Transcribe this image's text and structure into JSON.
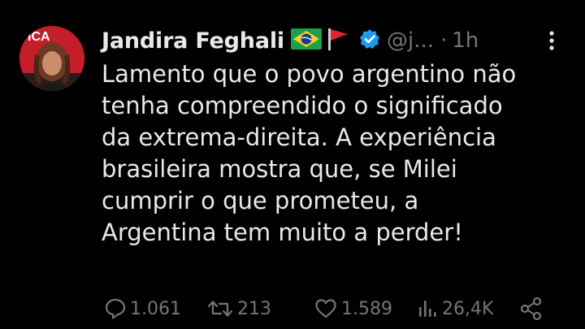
{
  "tweet": {
    "author_name": "Jandira Feghali",
    "flag_emoji": "🇧🇷",
    "red_flag_emoji": "🚩",
    "handle": "@j...",
    "separator": "·",
    "time": "1h",
    "text": "Lamento que o povo argentino não\ntenha compreendido o significado\nda extrema-direita. A experiência\nbrasileira mostra que, se Milei\ncumprir o que prometeu, a\nArgentina tem muito a perder!",
    "avatar_banner_text": "ICA"
  },
  "actions": {
    "replies": "1.061",
    "retweets": "213",
    "likes": "1.589",
    "views": "26,4K"
  },
  "icons": {
    "avatar": "profile-photo",
    "verified": "verified-badge-icon",
    "more": "more-options-icon",
    "reply": "reply-icon",
    "retweet": "retweet-icon",
    "like": "heart-icon",
    "views": "views-chart-icon",
    "share": "share-icon"
  },
  "colors": {
    "background": "#000000",
    "text": "#e7e9ea",
    "secondary": "#71767b",
    "verified": "#1d9bf0",
    "avatar_bg": "#c41e2a"
  }
}
